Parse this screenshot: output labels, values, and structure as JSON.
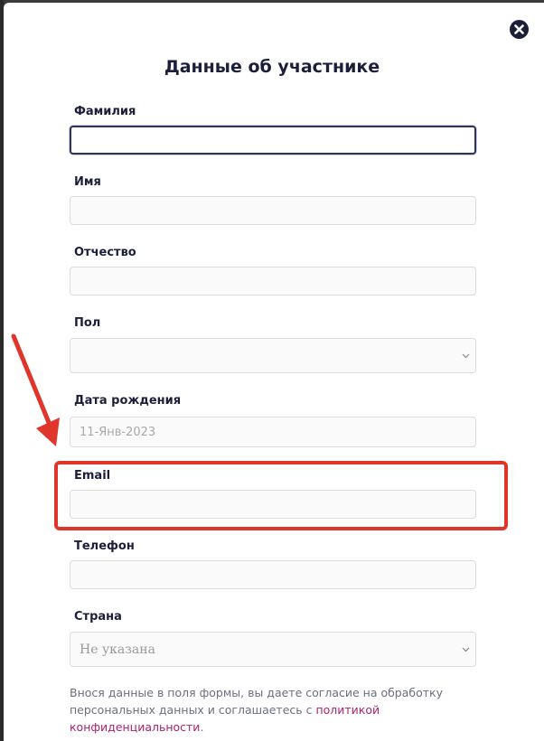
{
  "modal": {
    "title": "Данные об участнике"
  },
  "fields": {
    "last_name": {
      "label": "Фамилия",
      "value": ""
    },
    "first_name": {
      "label": "Имя",
      "value": ""
    },
    "middle_name": {
      "label": "Отчество",
      "value": ""
    },
    "gender": {
      "label": "Пол",
      "value": ""
    },
    "birth_date": {
      "label": "Дата рождения",
      "value": "11-Янв-2023"
    },
    "email": {
      "label": "Email",
      "value": ""
    },
    "phone": {
      "label": "Телефон",
      "value": ""
    },
    "country": {
      "label": "Страна",
      "value": "Не указана"
    }
  },
  "consent": {
    "text": "Внося данные в поля формы, вы даете согласие на обработку персональных данных и соглашаетесь с ",
    "link": "политикой конфиденциальности",
    "end": "."
  },
  "icons": {
    "close": "close-circle-icon",
    "chevron": "chevron-down-icon"
  },
  "colors": {
    "title": "#1c1f3a",
    "highlight": "#e0352b",
    "link": "#a8226f",
    "focus_border": "#2d3658"
  }
}
